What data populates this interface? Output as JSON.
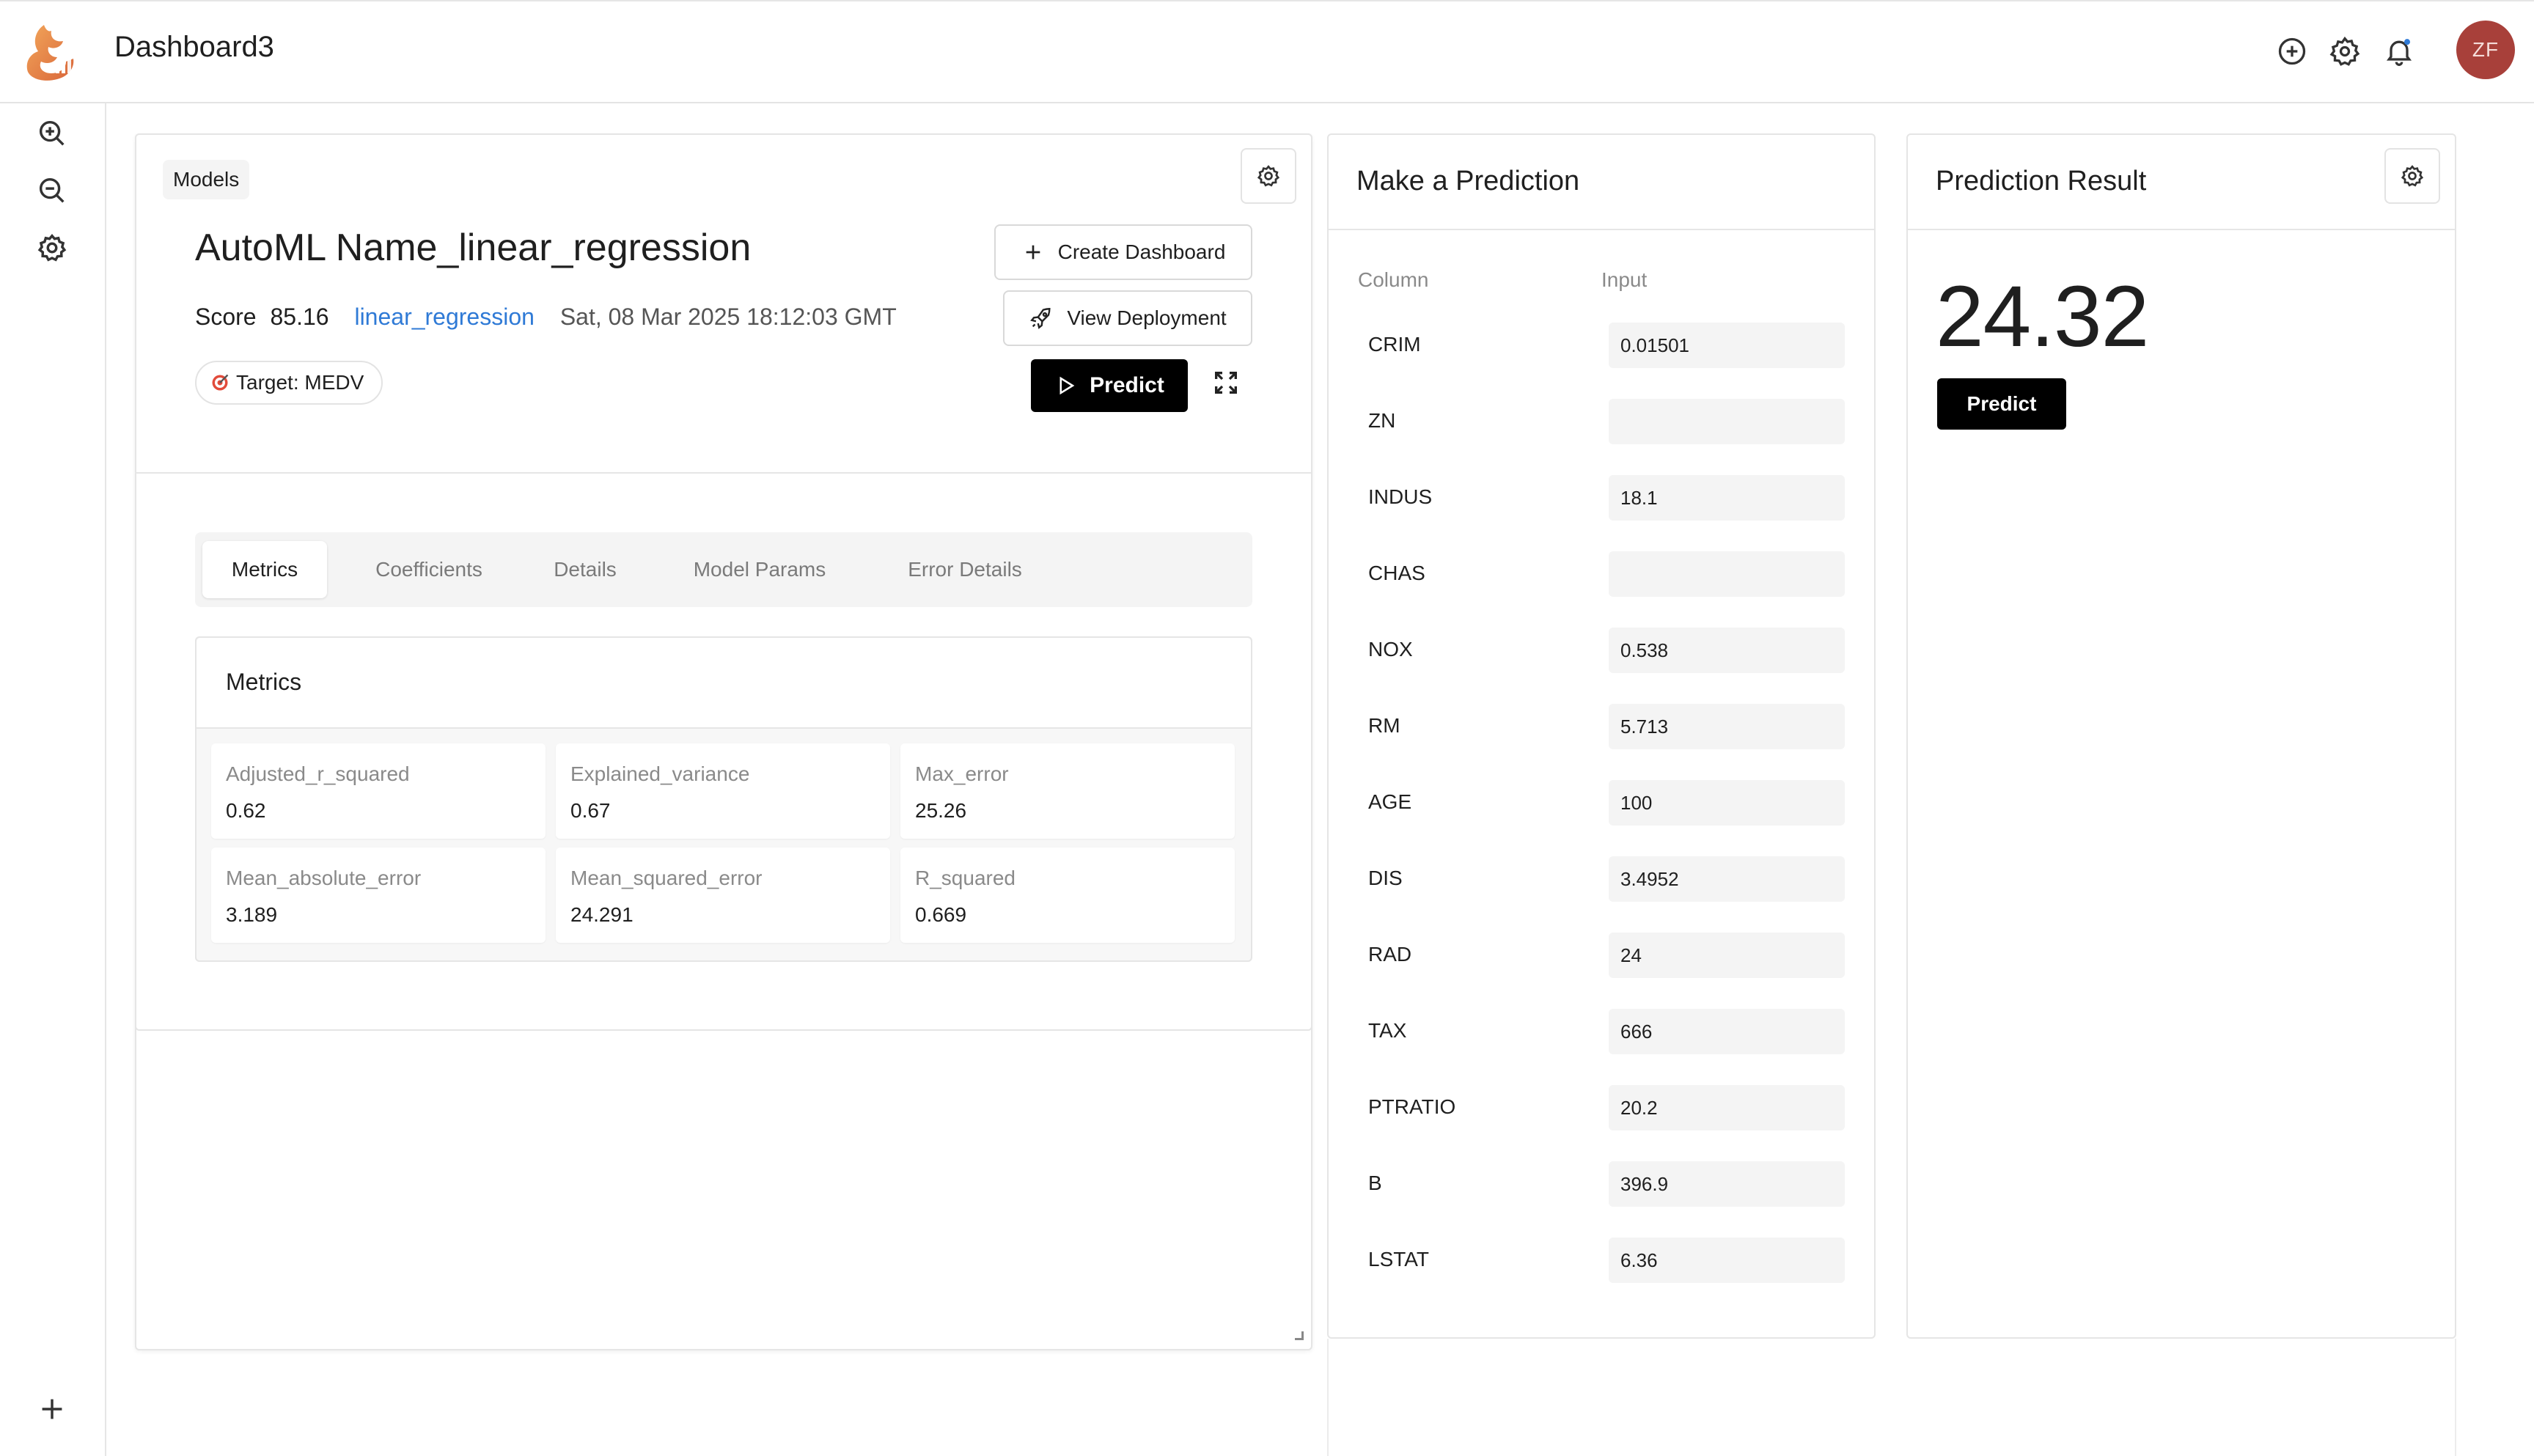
{
  "header": {
    "title": "Dashboard3",
    "avatar_initials": "ZF",
    "icons": [
      "add-circle-icon",
      "settings-icon",
      "notification-bell-icon"
    ]
  },
  "sidebar": {
    "icons": [
      "zoom-in-icon",
      "zoom-out-icon",
      "settings-icon",
      "add-icon"
    ]
  },
  "model_card": {
    "chip_label": "Models",
    "title": "AutoML Name_linear_regression",
    "score_label": "Score",
    "score_value": "85.16",
    "algorithm_link": "linear_regression",
    "timestamp": "Sat, 08 Mar 2025 18:12:03 GMT",
    "target_label": "Target: MEDV",
    "create_dashboard_label": "Create Dashboard",
    "view_deployment_label": "View Deployment",
    "predict_label": "Predict",
    "tabs": [
      {
        "label": "Metrics",
        "active": true
      },
      {
        "label": "Coefficients",
        "active": false
      },
      {
        "label": "Details",
        "active": false
      },
      {
        "label": "Model Params",
        "active": false
      },
      {
        "label": "Error Details",
        "active": false
      }
    ],
    "metrics_title": "Metrics",
    "metrics": [
      {
        "label": "Adjusted_r_squared",
        "value": "0.62"
      },
      {
        "label": "Explained_variance",
        "value": "0.67"
      },
      {
        "label": "Max_error",
        "value": "25.26"
      },
      {
        "label": "Mean_absolute_error",
        "value": "3.189"
      },
      {
        "label": "Mean_squared_error",
        "value": "24.291"
      },
      {
        "label": "R_squared",
        "value": "0.669"
      }
    ]
  },
  "prediction_form": {
    "title": "Make a Prediction",
    "column_header": "Column",
    "input_header": "Input",
    "rows": [
      {
        "column": "CRIM",
        "value": "0.01501"
      },
      {
        "column": "ZN",
        "value": ""
      },
      {
        "column": "INDUS",
        "value": "18.1"
      },
      {
        "column": "CHAS",
        "value": ""
      },
      {
        "column": "NOX",
        "value": "0.538"
      },
      {
        "column": "RM",
        "value": "5.713"
      },
      {
        "column": "AGE",
        "value": "100"
      },
      {
        "column": "DIS",
        "value": "3.4952"
      },
      {
        "column": "RAD",
        "value": "24"
      },
      {
        "column": "TAX",
        "value": "666"
      },
      {
        "column": "PTRATIO",
        "value": "20.2"
      },
      {
        "column": "B",
        "value": "396.9"
      },
      {
        "column": "LSTAT",
        "value": "6.36"
      }
    ]
  },
  "prediction_result": {
    "title": "Prediction Result",
    "value": "24.32",
    "predict_label": "Predict"
  },
  "colors": {
    "accent_link": "#2f7ad6",
    "primary_button": "#000000",
    "avatar_bg": "#a8403a",
    "logo_orange": "#e8874a"
  }
}
